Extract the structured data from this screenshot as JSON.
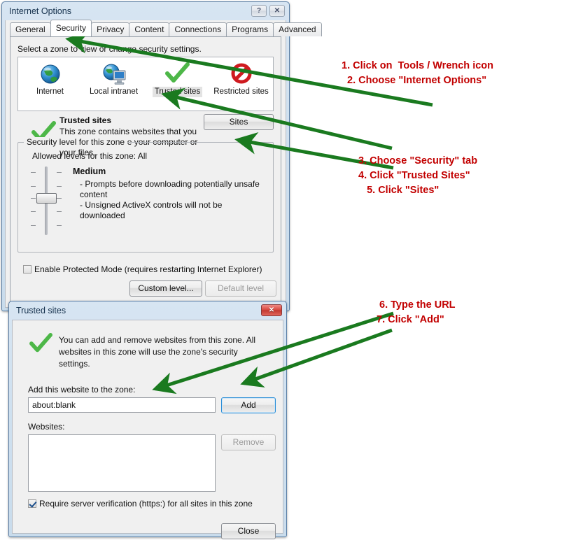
{
  "internet_options": {
    "title": "Internet Options",
    "help_button": "?",
    "close_button": "✕",
    "tabs": [
      {
        "label": "General",
        "active": false
      },
      {
        "label": "Security",
        "active": true
      },
      {
        "label": "Privacy",
        "active": false
      },
      {
        "label": "Content",
        "active": false
      },
      {
        "label": "Connections",
        "active": false
      },
      {
        "label": "Programs",
        "active": false
      },
      {
        "label": "Advanced",
        "active": false
      }
    ],
    "security": {
      "instruction": "Select a zone to view or change security settings.",
      "zones": [
        {
          "label": "Internet",
          "icon": "globe-icon",
          "selected": false
        },
        {
          "label": "Local intranet",
          "icon": "globe-computer-icon",
          "selected": false
        },
        {
          "label": "Trusted sites",
          "icon": "green-check-icon",
          "selected": true
        },
        {
          "label": "Restricted sites",
          "icon": "red-no-entry-icon",
          "selected": false
        }
      ],
      "selected_zone_title": "Trusted sites",
      "selected_zone_desc": "This zone contains websites that you trust not to damage your computer or your files.",
      "sites_button": "Sites",
      "group_legend": "Security level for this zone",
      "allowed_levels": "Allowed levels for this zone: All",
      "level_name": "Medium",
      "level_desc_line1": "- Prompts before downloading potentially unsafe content",
      "level_desc_line2": "- Unsigned ActiveX controls will not be downloaded",
      "protected_mode_label": "Enable Protected Mode (requires restarting Internet Explorer)",
      "protected_mode_checked": false,
      "custom_level_button": "Custom level...",
      "default_level_button": "Default level",
      "default_level_disabled": true
    }
  },
  "trusted_sites": {
    "title": "Trusted sites",
    "close_button": "✕",
    "info_icon": "green-check-icon",
    "info_text": "You can add and remove websites from this zone. All websites in this zone will use the zone's security settings.",
    "add_label": "Add this website to the zone:",
    "url_value": "about:blank",
    "url_placeholder": "",
    "add_button": "Add",
    "websites_label": "Websites:",
    "websites": [],
    "remove_button": "Remove",
    "remove_disabled": true,
    "require_https_label": "Require server verification (https:) for all sites in this zone",
    "require_https_checked": true,
    "close_dialog_button": "Close"
  },
  "annotations": {
    "color": "#c20000",
    "arrow_color": "#1a7a1f",
    "group1": "1. Click on  Tools / Wrench icon\n  2. Choose \"Internet Options\"",
    "group2": "3. Choose \"Security\" tab\n4. Click \"Trusted Sites\"\n   5. Click \"Sites\"",
    "group3": " 6. Type the URL\n7. Click \"Add\""
  }
}
